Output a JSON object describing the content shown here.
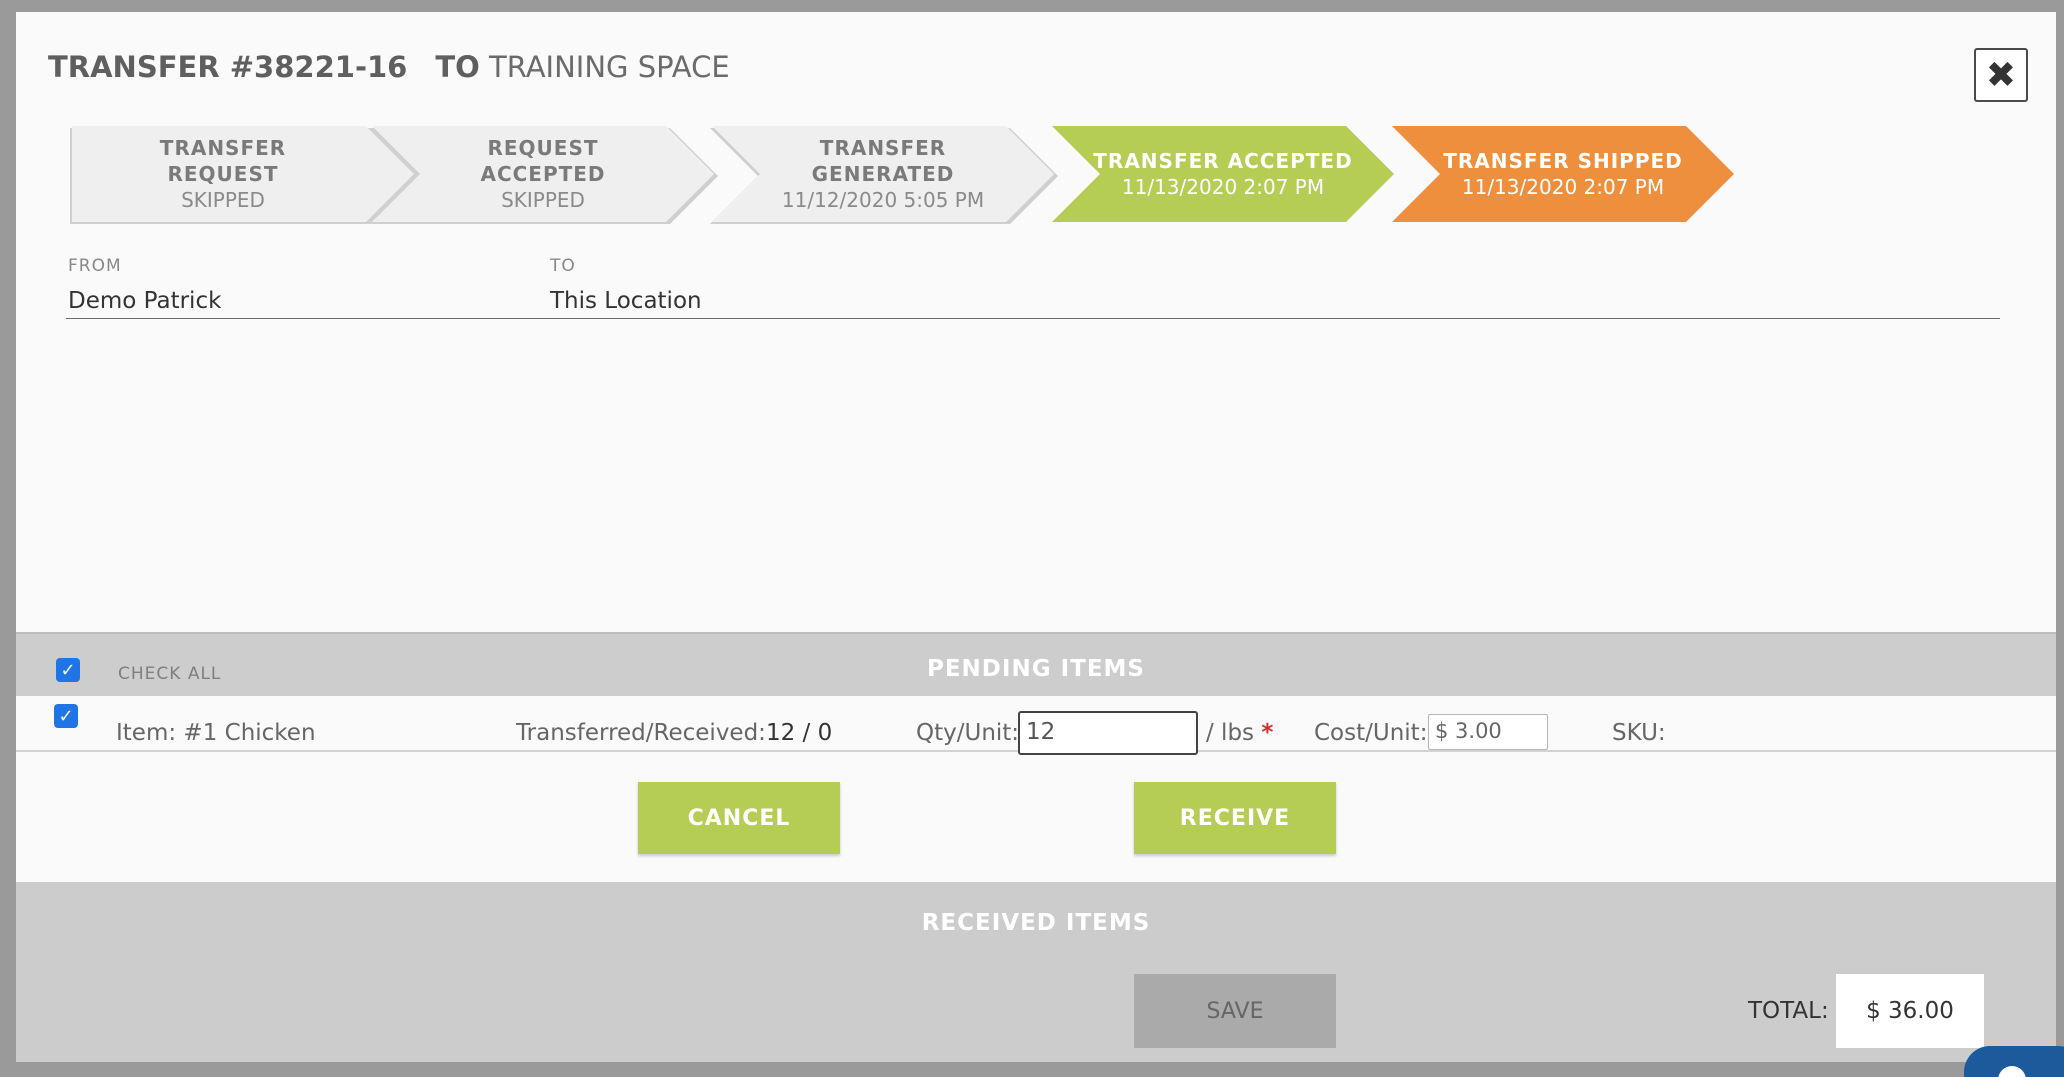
{
  "header": {
    "transfer_label": "TRANSFER #38221-16",
    "to_prefix": "TO",
    "to_name": "TRAINING SPACE",
    "close_glyph": "✖"
  },
  "steps": [
    {
      "line1": "TRANSFER",
      "line2": "REQUEST",
      "sub": "SKIPPED",
      "status": "grey"
    },
    {
      "line1": "REQUEST",
      "line2": "ACCEPTED",
      "sub": "SKIPPED",
      "status": "grey"
    },
    {
      "line1": "TRANSFER",
      "line2": "GENERATED",
      "sub": "11/12/2020 5:05 PM",
      "status": "grey"
    },
    {
      "line1": "TRANSFER ACCEPTED",
      "line2": "",
      "sub": "11/13/2020 2:07 PM",
      "status": "green"
    },
    {
      "line1": "TRANSFER SHIPPED",
      "line2": "",
      "sub": "11/13/2020 2:07 PM",
      "status": "orange"
    }
  ],
  "fields": {
    "from_label": "FROM",
    "from_value": "Demo Patrick",
    "to_label": "TO",
    "to_value": "This Location"
  },
  "pending": {
    "check_all_label": "CHECK ALL",
    "title": "PENDING ITEMS",
    "items": [
      {
        "item_label": "Item:",
        "item_value": "#1 Chicken",
        "transferred_label": "Transferred/Received:",
        "transferred_value": "12 / 0",
        "qty_label": "Qty/Unit:",
        "qty_value": "12",
        "unit": "/ lbs",
        "required_mark": "*",
        "cost_label": "Cost/Unit:",
        "cost_value": "$ 3.00",
        "sku_label": "SKU:"
      }
    ]
  },
  "actions": {
    "cancel_label": "CANCEL",
    "receive_label": "RECEIVE"
  },
  "received": {
    "title": "RECEIVED ITEMS",
    "save_label": "SAVE",
    "total_label": "TOTAL:",
    "total_value": "$ 36.00"
  },
  "colors": {
    "accent_green": "#b5cd55",
    "accent_orange": "#ee8f3e",
    "checkbox_blue": "#1f74e6"
  }
}
